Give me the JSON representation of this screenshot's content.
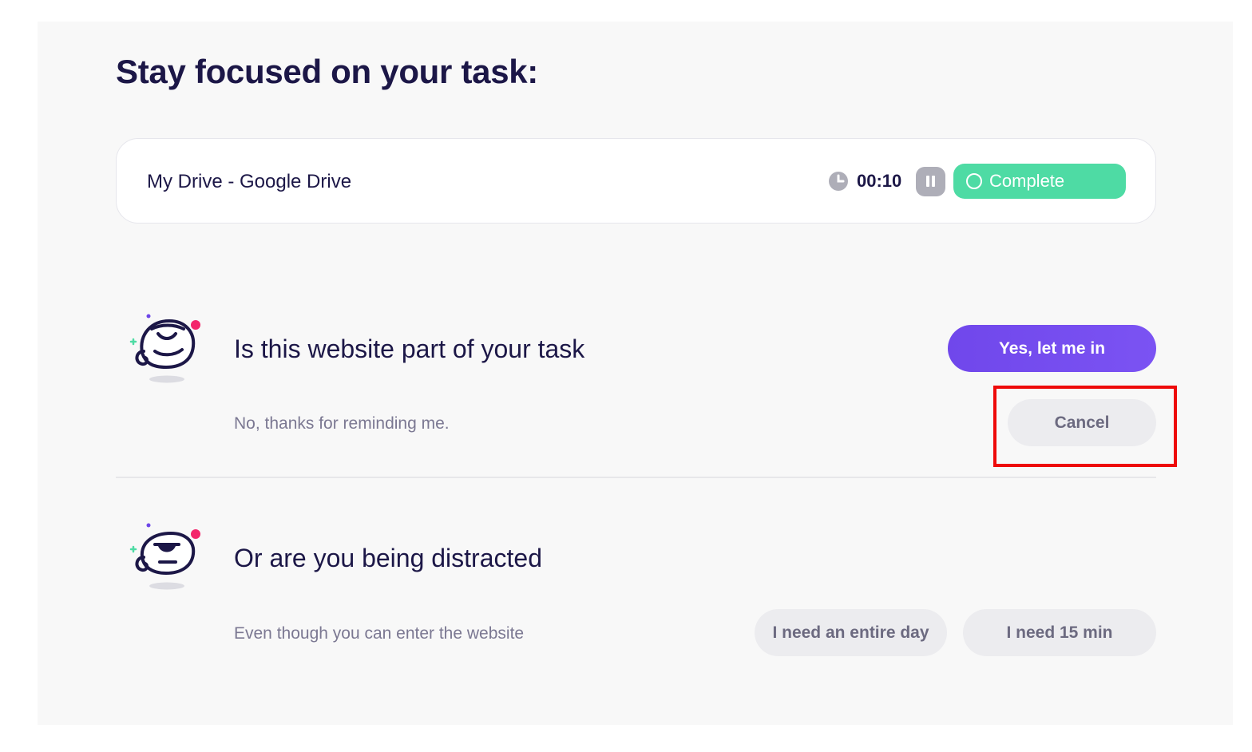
{
  "page": {
    "title": "Stay focused on your task:"
  },
  "task": {
    "name": "My Drive - Google Drive",
    "timer": "00:10",
    "complete_label": "Complete",
    "icons": [
      "clock-icon",
      "pause-icon",
      "circle-icon"
    ]
  },
  "question": {
    "title": "Is this website part of your task",
    "subtitle": "No, thanks for reminding me.",
    "yes_label": "Yes, let me in",
    "cancel_label": "Cancel",
    "mascot_icon": "happy-mascot-icon"
  },
  "distracted": {
    "title": "Or are you being distracted",
    "subtitle": "Even though you can enter the website",
    "day_label": "I need an entire day",
    "min_label": "I need 15 min",
    "mascot_icon": "grumpy-mascot-icon"
  },
  "colors": {
    "accent_purple": "#7047eb",
    "complete_green": "#4edba4",
    "title_navy": "#1c1747",
    "highlight_red": "#ee0a0a"
  }
}
